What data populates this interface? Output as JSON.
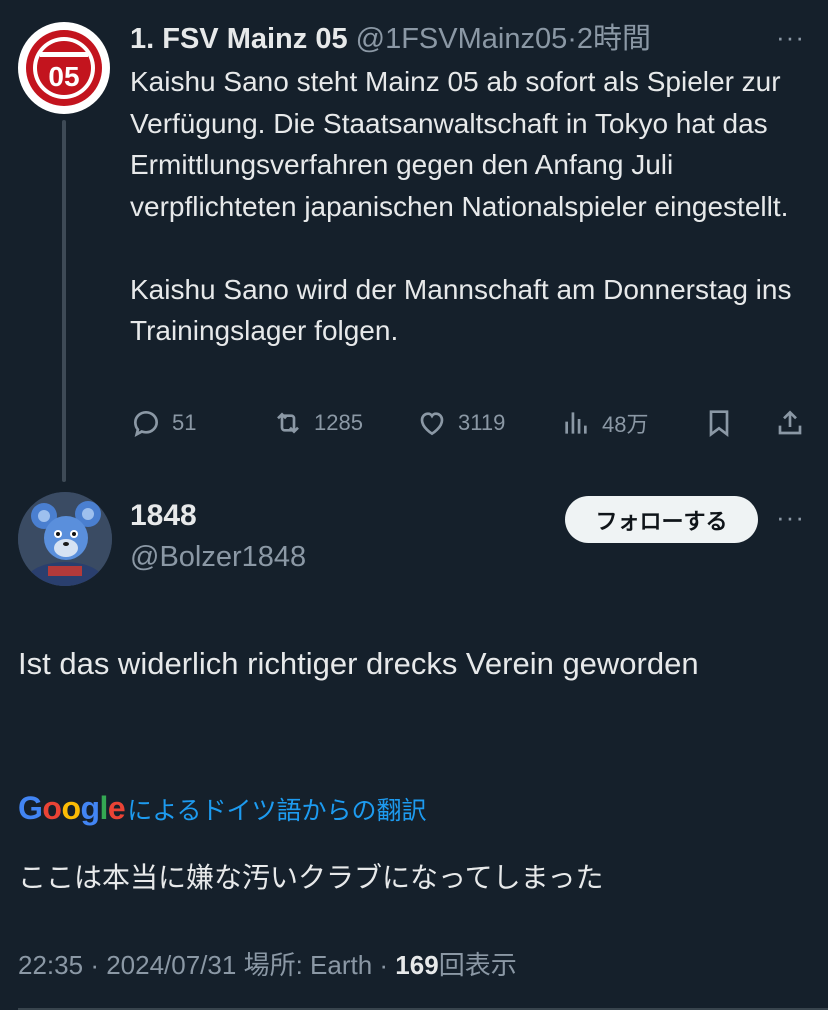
{
  "tweet1": {
    "name": "1. FSV Mainz 05",
    "handle": "@1FSVMainz05",
    "separator": "·",
    "time": "2時間",
    "more": "···",
    "body_p1": "Kaishu Sano steht Mainz 05 ab sofort als Spieler zur Verfügung. Die Staatsanwaltschaft in Tokyo hat das Ermittlungsverfahren gegen den Anfang Juli verpflichteten japanischen Nationalspieler eingestellt.",
    "body_p2": "Kaishu Sano wird der Mannschaft am Donnerstag ins Trainingslager folgen.",
    "avatar_logo_text": "05",
    "actions": {
      "replies": "51",
      "retweets": "1285",
      "likes": "3119",
      "views": "48万"
    },
    "icons": [
      "reply-icon",
      "retweet-icon",
      "like-icon",
      "views-icon",
      "bookmark-icon",
      "share-icon"
    ]
  },
  "tweet2": {
    "name": "1848",
    "handle": "@Bolzer1848",
    "follow_label": "フォローする",
    "more": "···",
    "body": "Ist das widerlich richtiger drecks Verein geworden",
    "translate_brand": "Google",
    "translate_label": "によるドイツ語からの翻訳",
    "translated_text": "ここは本当に嫌な汚いクラブになってしまった",
    "meta": {
      "time": "22:35",
      "date": "2024/07/31",
      "location": "場所: Earth",
      "views_count": "169",
      "views_label": "回表示"
    }
  },
  "colors": {
    "background": "#15202b",
    "text": "#e7e9ea",
    "muted": "#8b98a5",
    "link": "#1d9bf0",
    "club_red": "#c3141e"
  }
}
